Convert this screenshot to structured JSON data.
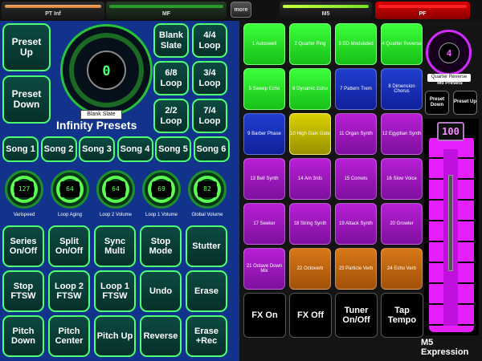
{
  "tabs": {
    "pt": "PT Inf",
    "mf": "MF",
    "more": "more",
    "m5": "M5",
    "pf": "PF"
  },
  "colors": {
    "accent_green": "#4dff72",
    "left_bg": "#11338c",
    "m5_purple": "#e61fff",
    "pf_red": "#ff2020"
  },
  "infinity": {
    "preset_up": "Preset Up",
    "preset_down": "Preset Down",
    "dial_value": "0",
    "dial_caption": "Blank Slate",
    "title": "Infinity Presets",
    "loops": [
      "Blank Slate",
      "4/4 Loop",
      "6/8 Loop",
      "3/4 Loop",
      "2/2 Loop",
      "7/4 Loop"
    ],
    "songs": [
      "Song 1",
      "Song 2",
      "Song 3",
      "Song 4",
      "Song 5",
      "Song 6"
    ],
    "knobs": [
      {
        "value": "127",
        "label": "Varispeed"
      },
      {
        "value": "64",
        "label": "Loop Aging"
      },
      {
        "value": "64",
        "label": "Loop 2 Volume"
      },
      {
        "value": "69",
        "label": "Loop 1 Volume"
      },
      {
        "value": "82",
        "label": "Global Volume"
      }
    ],
    "controls": [
      [
        "Series On/Off",
        "Split On/Off",
        "Sync Multi",
        "Stop Mode",
        "Stutter"
      ],
      [
        "Stop FTSW",
        "Loop 2 FTSW",
        "Loop 1 FTSW",
        "Undo",
        "Erase"
      ],
      [
        "Pitch Down",
        "Pitch Center",
        "Pitch Up",
        "Reverse",
        "Erase +Rec"
      ]
    ]
  },
  "m5_presets": [
    {
      "label": "1 Autoswell",
      "color": "green"
    },
    {
      "label": "2 Quarter Ping",
      "color": "green"
    },
    {
      "label": "3 DD Modulated",
      "color": "green"
    },
    {
      "label": "4 Quarter Reverse",
      "color": "green"
    },
    {
      "label": "5 Sweep Echo",
      "color": "green"
    },
    {
      "label": "6 Dynamic Echo",
      "color": "green"
    },
    {
      "label": "7 Pattern Trem",
      "color": "blue"
    },
    {
      "label": "8 Dimension Chorus",
      "color": "blue"
    },
    {
      "label": "9 Barber Phase",
      "color": "blue"
    },
    {
      "label": "10 High Gain Gate",
      "color": "yellow"
    },
    {
      "label": "11 Organ Synth",
      "color": "purple"
    },
    {
      "label": "12 Egyptian Synth",
      "color": "purple"
    },
    {
      "label": "13 Bell Synth",
      "color": "purple"
    },
    {
      "label": "14 Am 3rds",
      "color": "purple"
    },
    {
      "label": "15 Comets",
      "color": "purple"
    },
    {
      "label": "16 Slow Voice",
      "color": "purple"
    },
    {
      "label": "17 Seeker",
      "color": "purple"
    },
    {
      "label": "18 String Synth",
      "color": "purple"
    },
    {
      "label": "19 Attack Synth",
      "color": "purple"
    },
    {
      "label": "20 Growler",
      "color": "purple"
    },
    {
      "label": "21 Octave Down Mix",
      "color": "purple"
    },
    {
      "label": "22 Octoverb",
      "color": "orange"
    },
    {
      "label": "23 Particle Verb",
      "color": "orange"
    },
    {
      "label": "24 Echo Verb",
      "color": "orange"
    }
  ],
  "fx_buttons": [
    "FX On",
    "FX Off",
    "Tuner On/Off",
    "Tap Tempo"
  ],
  "m5_panel": {
    "dial_value": "4",
    "caption": "Quarter Reverse",
    "presets_label": "M5 Presets",
    "preset_down": "Preset Down",
    "preset_up": "Preset Up",
    "expression_value": "100",
    "expression_level": 1.0,
    "expression_label": "M5 Expression"
  }
}
